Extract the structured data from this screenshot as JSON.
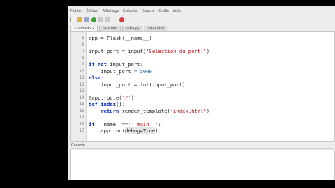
{
  "menu": [
    "Fichier",
    "Édition",
    "Affichage",
    "Exécuter",
    "Source",
    "Outils",
    "Aide"
  ],
  "toolbar": {
    "icons": [
      "new-file-icon",
      "open-file-icon",
      "save-icon",
      "run-icon",
      "stop-icon",
      "debug-icon",
      "close-icon"
    ]
  },
  "tabs": [
    {
      "label": "<untitled> x"
    },
    {
      "label": "base.htm"
    },
    {
      "label": "index.py"
    },
    {
      "label": "index.html"
    }
  ],
  "editor": {
    "lines": [
      {
        "n": "5",
        "html": "app = Flask(__name__)"
      },
      {
        "n": "6",
        "html": ""
      },
      {
        "n": "7",
        "html": "input_port = input(<span class='str'>'Selection du port:'</span>)"
      },
      {
        "n": "8",
        "html": ""
      },
      {
        "n": "9",
        "html": "<span class='kw'>if not</span> input_port:"
      },
      {
        "n": "10",
        "html": "    input_port = <span class='num'>5000</span>"
      },
      {
        "n": "11",
        "html": "<span class='kw'>else</span>:"
      },
      {
        "n": "12",
        "html": "    input_port = int(input_port)"
      },
      {
        "n": "13",
        "html": ""
      },
      {
        "n": "14",
        "html": "@app.route(<span class='str'>'/'</span>)"
      },
      {
        "n": "15",
        "html": "<span class='kw'>def index</span>():"
      },
      {
        "n": "16",
        "html": "    <span class='kw'>return</span> render_template(<span class='str'>'index.html'</span>)"
      },
      {
        "n": "17",
        "html": ""
      },
      {
        "n": "18",
        "html": "<span class='kw'>if</span> __name__==<span class='str'>'__main__'</span>:"
      },
      {
        "n": "17",
        "html": "    app.run(<span class='cursor-hl'>debug=True</span>)"
      }
    ]
  },
  "console": {
    "label": "Console"
  }
}
